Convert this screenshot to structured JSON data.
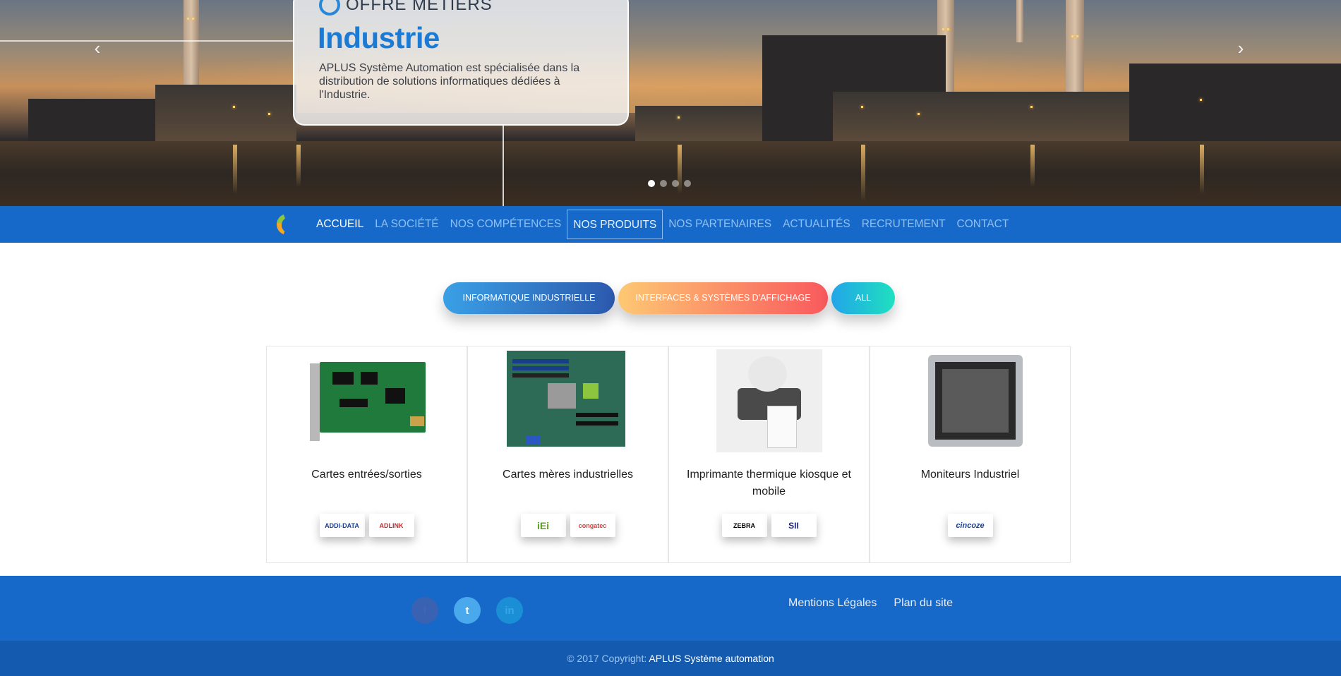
{
  "hero": {
    "eyebrow": "OFFRE METIERS",
    "title": "Industrie",
    "text": "APLUS Système Automation est spécialisée dans la distribution de solutions informatiques dédiées à l'Industrie.",
    "prev_icon": "chevron-left-icon",
    "next_icon": "chevron-right-icon",
    "slides_count": 4,
    "active_slide": 1
  },
  "nav": {
    "items": [
      {
        "label": "ACCUEIL"
      },
      {
        "label": "LA SOCIÉTÉ"
      },
      {
        "label": "NOS COMPÉTENCES"
      },
      {
        "label": "NOS PRODUITS"
      },
      {
        "label": "NOS PARTENAIRES"
      },
      {
        "label": "ACTUALITÉS"
      },
      {
        "label": "RECRUTEMENT"
      },
      {
        "label": "CONTACT"
      }
    ],
    "active": "ACCUEIL",
    "focused": "NOS PRODUITS"
  },
  "filters": [
    {
      "label": "INFORMATIQUE INDUSTRIELLE"
    },
    {
      "label": "INTERFACES & SYSTÈMES D'AFFICHAGE"
    },
    {
      "label": "ALL"
    }
  ],
  "products": [
    {
      "title": "Cartes entrées/sorties",
      "brands": [
        "ADDI-DATA",
        "ADLINK"
      ]
    },
    {
      "title": "Cartes mères industrielles",
      "brands": [
        "iEi",
        "congatec"
      ]
    },
    {
      "title": "Imprimante thermique kiosque et mobile",
      "brands": [
        "ZEBRA",
        "SII"
      ]
    },
    {
      "title": "Moniteurs Industriel",
      "brands": [
        "cincoze"
      ]
    }
  ],
  "footer": {
    "social": [
      {
        "name": "facebook",
        "glyph": "f"
      },
      {
        "name": "twitter",
        "glyph": "t"
      },
      {
        "name": "linkedin",
        "glyph": "in"
      }
    ],
    "links": [
      "Mentions Légales",
      "Plan du site"
    ],
    "copyright_prefix": "© 2017 Copyright:",
    "copyright_company": "APLUS Système automation"
  },
  "colors": {
    "nav_bg": "#1668c9",
    "footer_bg": "#1668c9",
    "copyright_bg": "#145bb0",
    "hero_title": "#1b7bd4"
  }
}
